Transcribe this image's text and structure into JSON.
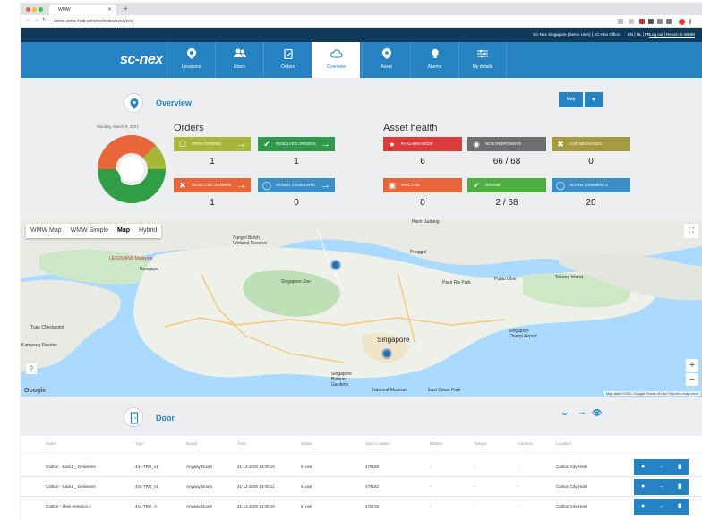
{
  "browser": {
    "tab_title": "WMW",
    "url": "demo.wmw-hub.com/en/vision/overview",
    "colors": {
      "close": "#f15f57",
      "min": "#f8bc2f",
      "max": "#2ac940"
    }
  },
  "topstrip": {
    "session": "SC-Nex Singapore (Demo User) | SC-Nex Office",
    "languages": "EN | NL | FR",
    "links": "Log out | Return to WMW"
  },
  "navbar": {
    "logo": "sc-nex",
    "items": [
      {
        "label": "Locations",
        "icon": "location-pin-icon"
      },
      {
        "label": "Users",
        "icon": "users-icon"
      },
      {
        "label": "Orders",
        "icon": "clipboard-check-icon"
      },
      {
        "label": "Overview",
        "icon": "cloud-icon",
        "active": true
      },
      {
        "label": "Asset",
        "icon": "asset-pin-icon"
      },
      {
        "label": "Alarms",
        "icon": "alarm-bulb-icon"
      },
      {
        "label": "My details",
        "icon": "sliders-icon"
      }
    ],
    "color": "#2583c3"
  },
  "overview": {
    "title": "Overview",
    "map_button": "Map",
    "date": "Monday, March 8, 2021",
    "donut_colors": [
      "#e8663a",
      "#2f9e44",
      "#a6b738"
    ],
    "donut_values": [
      0.25,
      0.4,
      0.35
    ]
  },
  "orders": {
    "title": "Orders",
    "tiles": [
      {
        "label": "Open orders",
        "value": "1",
        "color": "#a8b73a",
        "icon": "clipboard-icon"
      },
      {
        "label": "Resolved orders",
        "value": "1",
        "color": "#2f9a4c",
        "icon": "check-icon"
      },
      {
        "label": "Rejected orders",
        "value": "1",
        "color": "#e8663a",
        "icon": "x-icon"
      },
      {
        "label": "Order comments",
        "value": "0",
        "color": "#3a8fc8",
        "icon": "comment-icon"
      }
    ]
  },
  "asset_health": {
    "title": "Asset health",
    "tiles": [
      {
        "label": "In alarm mode",
        "value": "6",
        "color": "#d93d3d",
        "icon": "alarm-icon"
      },
      {
        "label": "Non responsive",
        "value": "66 / 68",
        "color": "#6e6e6e",
        "icon": "signal-icon"
      },
      {
        "label": "Log messages",
        "value": "0",
        "color": "#a59a3f",
        "icon": "x-icon"
      },
      {
        "label": "Inactive",
        "value": "0",
        "color": "#e8663a",
        "icon": "inactive-icon"
      },
      {
        "label": "Online",
        "value": "2 / 68",
        "color": "#4caf3f",
        "icon": "check-icon"
      },
      {
        "label": "Alarm comments",
        "value": "20",
        "color": "#3a8fc8",
        "icon": "comment-icon"
      }
    ]
  },
  "map": {
    "types": [
      "WMW Map",
      "WMW Simple",
      "Map",
      "Hybrid"
    ],
    "active_type": "Map",
    "zoom_level": "0",
    "attribution": "Map data ©2021 Google   Terms of Use   Report a map error",
    "google": "Google",
    "labels": {
      "pasir_gudang": "Pasir Gudang",
      "legoland": "LEGOLAND Malaysia",
      "nusajaya": "Nusajaya",
      "sungei_buloh": "Sungei Buloh Wetland Reserve",
      "punggol": "Punggol",
      "pasir_ris": "Pasir Ris Park",
      "pulau_ubin": "Pulau Ubin",
      "tekong": "Tekong Island",
      "sg_zoo": "Singapore Zoo",
      "tuas": "Tuas Checkpoint",
      "changi": "Singapore Changi Airport",
      "singapore": "Singapore",
      "botanic": "Singapore Botanic Gardens",
      "museum": "National Museum",
      "eastcoast": "East Coast Park",
      "kampong": "Kampong Pendas"
    }
  },
  "door": {
    "title": "Door",
    "columns": [
      "Name",
      "Type",
      "Brand",
      "Time",
      "Status",
      "Open counter",
      "Battery",
      "Tamper",
      "Intrusion",
      "Location"
    ],
    "rows": [
      [
        "Carlton - Back1 _ Deliveries",
        "444-TRG_v1",
        "Anyway Doors",
        "21-12-2020 14:00:10",
        "In use",
        "478169",
        "-",
        "-",
        "-",
        "Carlton City Hotel"
      ],
      [
        "Carlton - Back1 _ Deliveries",
        "444-TRG_v1",
        "Anyway Doors",
        "21-12-2020 14:00:11",
        "In use",
        "479182",
        "-",
        "-",
        "-",
        "Carlton City Hotel"
      ],
      [
        "Carlton - Main entrance 1",
        "444-TRG_A",
        "Anyway Doors",
        "21-12-2020 14:00:10",
        "In use",
        "476718",
        "-",
        "-",
        "-",
        "Carlton City Hotel"
      ]
    ]
  }
}
